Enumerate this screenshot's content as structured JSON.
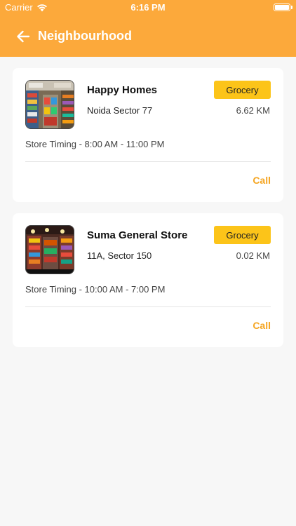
{
  "status_bar": {
    "carrier": "Carrier",
    "time": "6:16 PM",
    "wifi_icon": "wifi-icon",
    "battery_icon": "battery-icon"
  },
  "header": {
    "title": "Neighbourhood",
    "back_icon": "arrow-left-icon",
    "background_color": "#fca93b"
  },
  "stores": [
    {
      "name": "Happy Homes",
      "address": "Noida Sector 77",
      "category": "Grocery",
      "distance": "6.62 KM",
      "timing": "Store Timing - 8:00 AM - 11:00 PM",
      "call_label": "Call"
    },
    {
      "name": "Suma General Store",
      "address": "11A, Sector 150",
      "category": "Grocery",
      "distance": "0.02 KM",
      "timing": "Store Timing - 10:00 AM - 7:00 PM",
      "call_label": "Call"
    }
  ],
  "colors": {
    "accent": "#fca93b",
    "badge": "#fcc419",
    "call_text": "#f5a623",
    "background": "#f7f7f7"
  }
}
